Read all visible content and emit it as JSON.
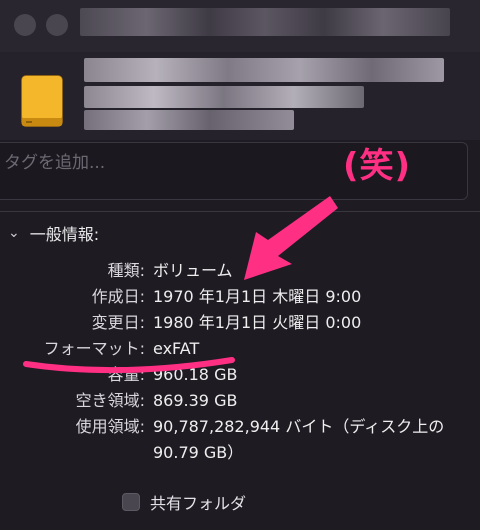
{
  "window": {
    "tag_placeholder": "タグを追加..."
  },
  "general": {
    "section_title": "一般情報:",
    "rows": [
      {
        "label": "種類:",
        "value": "ボリューム"
      },
      {
        "label": "作成日:",
        "value": "1970 年1月1日 木曜日 9:00"
      },
      {
        "label": "変更日:",
        "value": "1980 年1月1日 火曜日 0:00"
      },
      {
        "label": "フォーマット:",
        "value": "exFAT"
      },
      {
        "label": "容量:",
        "value": "960.18 GB"
      },
      {
        "label": "空き領域:",
        "value": "869.39 GB"
      },
      {
        "label": "使用領域:",
        "value": "90,787,282,944 バイト（ディスク上の 90.79 GB）"
      }
    ],
    "shared_folder_label": "共有フォルダ"
  },
  "annotation": {
    "text": "(笑)",
    "color": "#ff2f84"
  },
  "icons": {
    "drive": "external-drive-icon",
    "chevron": "chevron-down-icon"
  }
}
